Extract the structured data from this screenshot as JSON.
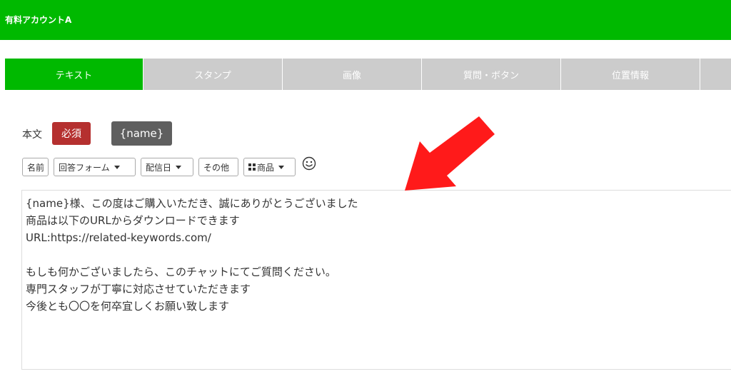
{
  "header": {
    "account_name": "有料アカウントA",
    "bg_color": "#00b900"
  },
  "tabs": [
    {
      "label": "テキスト",
      "active": true
    },
    {
      "label": "スタンプ",
      "active": false
    },
    {
      "label": "画像",
      "active": false
    },
    {
      "label": "質問・ボタン",
      "active": false
    },
    {
      "label": "位置情報",
      "active": false
    }
  ],
  "form": {
    "label": "本文",
    "required_badge": "必須",
    "name_variable": "{name}",
    "toolbar": {
      "name_btn": "名前",
      "form_btn": "回答フォーム",
      "date_btn": "配信日",
      "other_btn": "その他",
      "product_btn": "商品",
      "emoji": "smiley-icon"
    },
    "message_lines": [
      "{name}様、この度はご購入いただき、誠にありがとうございました",
      "商品は以下のURLからダウンロードできます",
      "URL:https://related-keywords.com/",
      "",
      "もしも何かございましたら、このチャットにてご質問ください。",
      "専門スタッフが丁寧に対応させていただきます",
      "今後とも〇〇を何卒宜しくお願い致します"
    ]
  },
  "annotation": {
    "arrow_color": "#ff1a1a",
    "arrow_icon": "arrow-pointer-icon"
  }
}
